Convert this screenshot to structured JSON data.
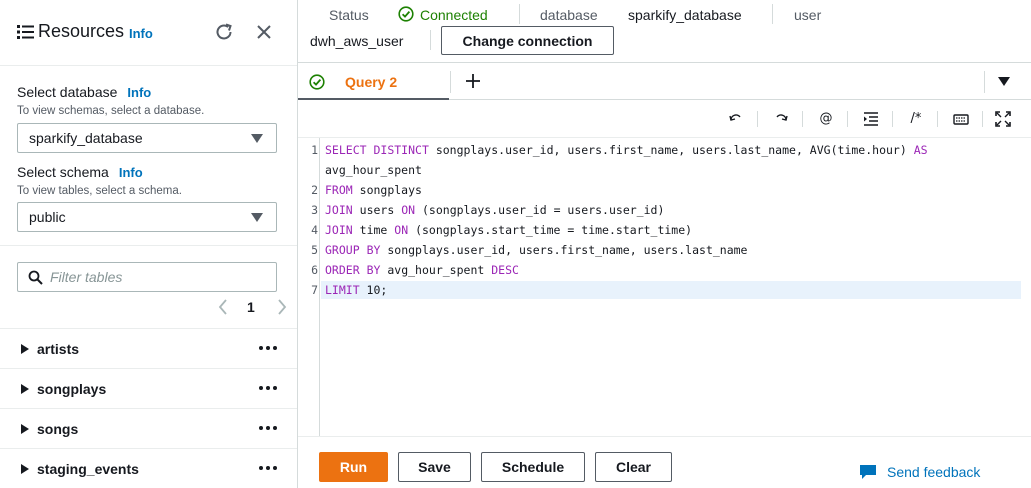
{
  "sidebar": {
    "title": "Resources",
    "title_info": "Info",
    "database": {
      "label": "Select database",
      "info": "Info",
      "hint": "To view schemas, select a database.",
      "value": "sparkify_database"
    },
    "schema": {
      "label": "Select schema",
      "info": "Info",
      "hint": "To view tables, select a schema.",
      "value": "public"
    },
    "filter_placeholder": "Filter tables",
    "page": "1",
    "tables": [
      "artists",
      "songplays",
      "songs",
      "staging_events"
    ]
  },
  "status": {
    "status_label": "Status",
    "status_value": "Connected",
    "database_label": "database",
    "database_value": "sparkify_database",
    "user_label": "user",
    "user_value": "dwh_aws_user",
    "change_button": "Change connection"
  },
  "tabs": [
    {
      "label": "Query 2",
      "active": true
    }
  ],
  "editor": {
    "line_numbers": [
      "1",
      "2",
      "3",
      "4",
      "5",
      "6",
      "7"
    ],
    "lines": [
      "SELECT DISTINCT songplays.user_id, users.first_name, users.last_name, AVG(time.hour) AS",
      "avg_hour_spent",
      "FROM songplays",
      "JOIN users ON (songplays.user_id = users.user_id)",
      "JOIN time ON (songplays.start_time = time.start_time)",
      "GROUP BY songplays.user_id, users.first_name, users.last_name",
      "ORDER BY avg_hour_spent DESC",
      "LIMIT 10;"
    ]
  },
  "toolbar": {
    "icons": [
      "undo-icon",
      "redo-icon",
      "at-icon",
      "indent-icon",
      "comment-icon",
      "keyboard-icon",
      "fullscreen-icon"
    ],
    "at_glyph": "@",
    "comment_glyph": "/*"
  },
  "footer": {
    "run": "Run",
    "save": "Save",
    "schedule": "Schedule",
    "clear": "Clear",
    "feedback": "Send feedback"
  },
  "colors": {
    "accent": "#ec7211",
    "link": "#0073bb",
    "success": "#1d8102",
    "keyword": "#9b26b6"
  }
}
